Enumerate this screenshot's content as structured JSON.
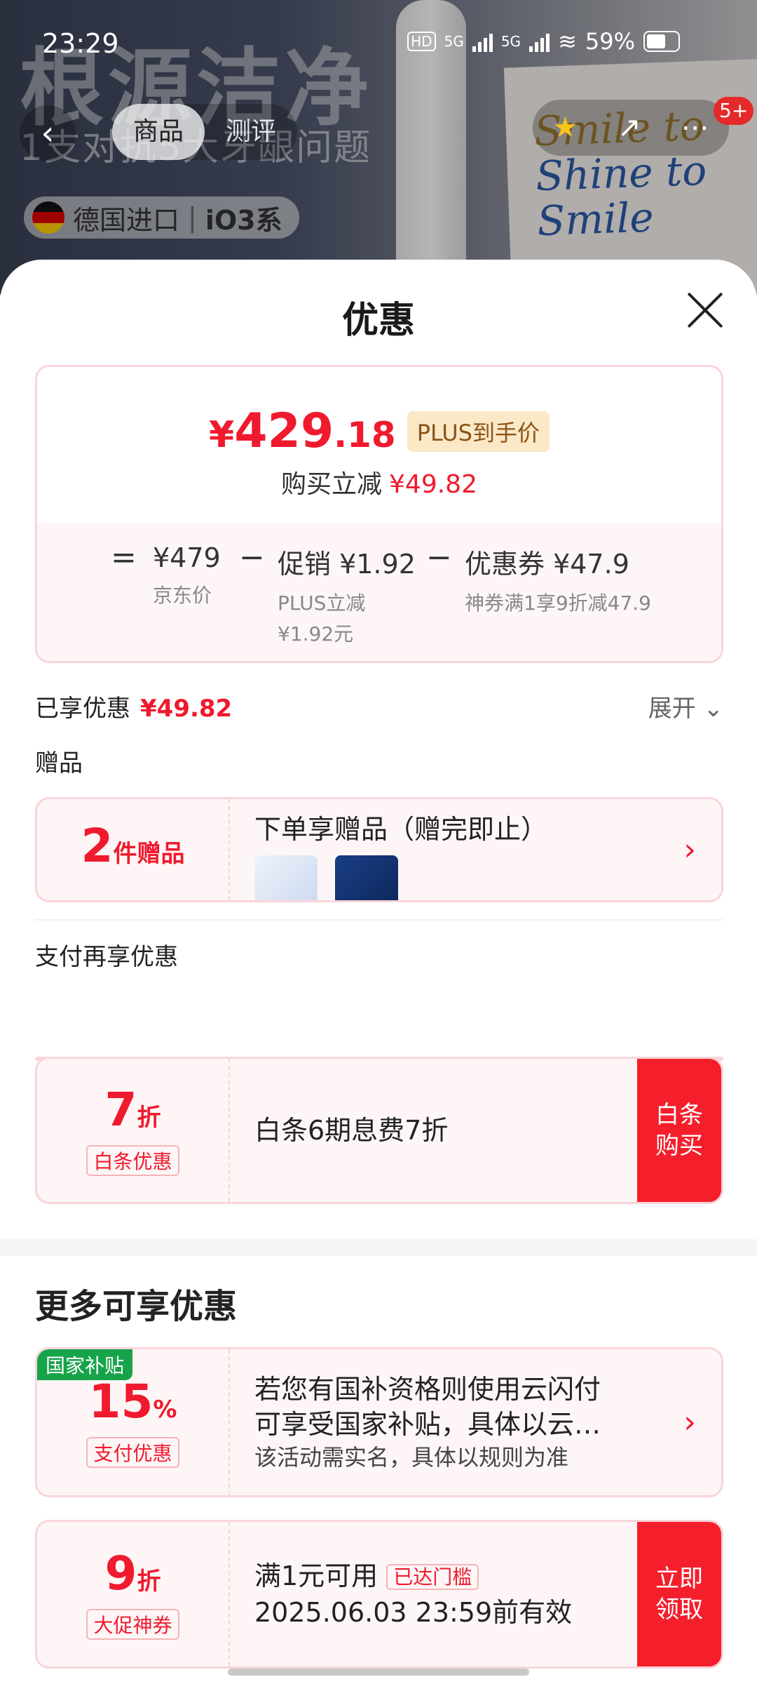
{
  "status_bar": {
    "time": "23:29",
    "battery": "59%",
    "network_1": "5G",
    "network_2": "5G",
    "hd": "HD"
  },
  "background": {
    "title": "根源洁净",
    "subtitle": "1支对抗5大牙龈问题",
    "origin": "德国进口",
    "series": "iO3系",
    "box_text_1": "Smile to",
    "box_text_2": "Shine to",
    "box_text_3": "Smile",
    "nav_tabs": [
      "商品",
      "测评"
    ],
    "cart_badge": "5+"
  },
  "sheet": {
    "title": "优惠",
    "price": {
      "yen": "¥",
      "integer": "429",
      "decimal": ".18",
      "tag": "PLUS到手价",
      "reduce_label": "购买立减",
      "reduce_value": "¥49.82"
    },
    "breakdown": {
      "equals": "=",
      "jd_price": "¥479",
      "jd_label": "京东价",
      "minus": "−",
      "promo": "促销 ¥1.92",
      "promo_desc_1": "PLUS立减",
      "promo_desc_2": "¥1.92元",
      "coupon": "优惠券 ¥47.9",
      "coupon_desc": "神券满1享9折减47.9"
    },
    "enjoyed": {
      "label": "已享优惠",
      "value": "¥49.82",
      "expand": "展开"
    },
    "gift_section": {
      "label": "赠品",
      "count": "2",
      "count_unit": "件赠品",
      "title": "下单享赠品（赠完即止）"
    },
    "pay_section": {
      "label": "支付再享优惠",
      "discount": "7",
      "discount_unit": "折",
      "tag": "白条优惠",
      "desc": "白条6期息费7折",
      "button": "白条\n购买"
    },
    "more": {
      "title": "更多可享优惠",
      "subsidy": {
        "badge": "国家补贴",
        "value": "15",
        "unit": "%",
        "tag": "支付优惠",
        "line1": "若您有国补资格则使用云闪付",
        "line2": "可享受国家补贴，具体以云…",
        "line3": "该活动需实名，具体以规则为准"
      },
      "coupon": {
        "value": "9",
        "unit": "折",
        "tag": "大促神券",
        "line1": "满1元可用",
        "reached": "已达门槛",
        "line2": "2025.06.03 23:59前有效",
        "button": "立即\n领取"
      }
    }
  },
  "colors": {
    "accent": "#f01a2e",
    "button": "#f51f2c",
    "card_bg": "#fef6f6",
    "card_border": "#f8d5d9",
    "subsidy_green": "#17a34a"
  }
}
